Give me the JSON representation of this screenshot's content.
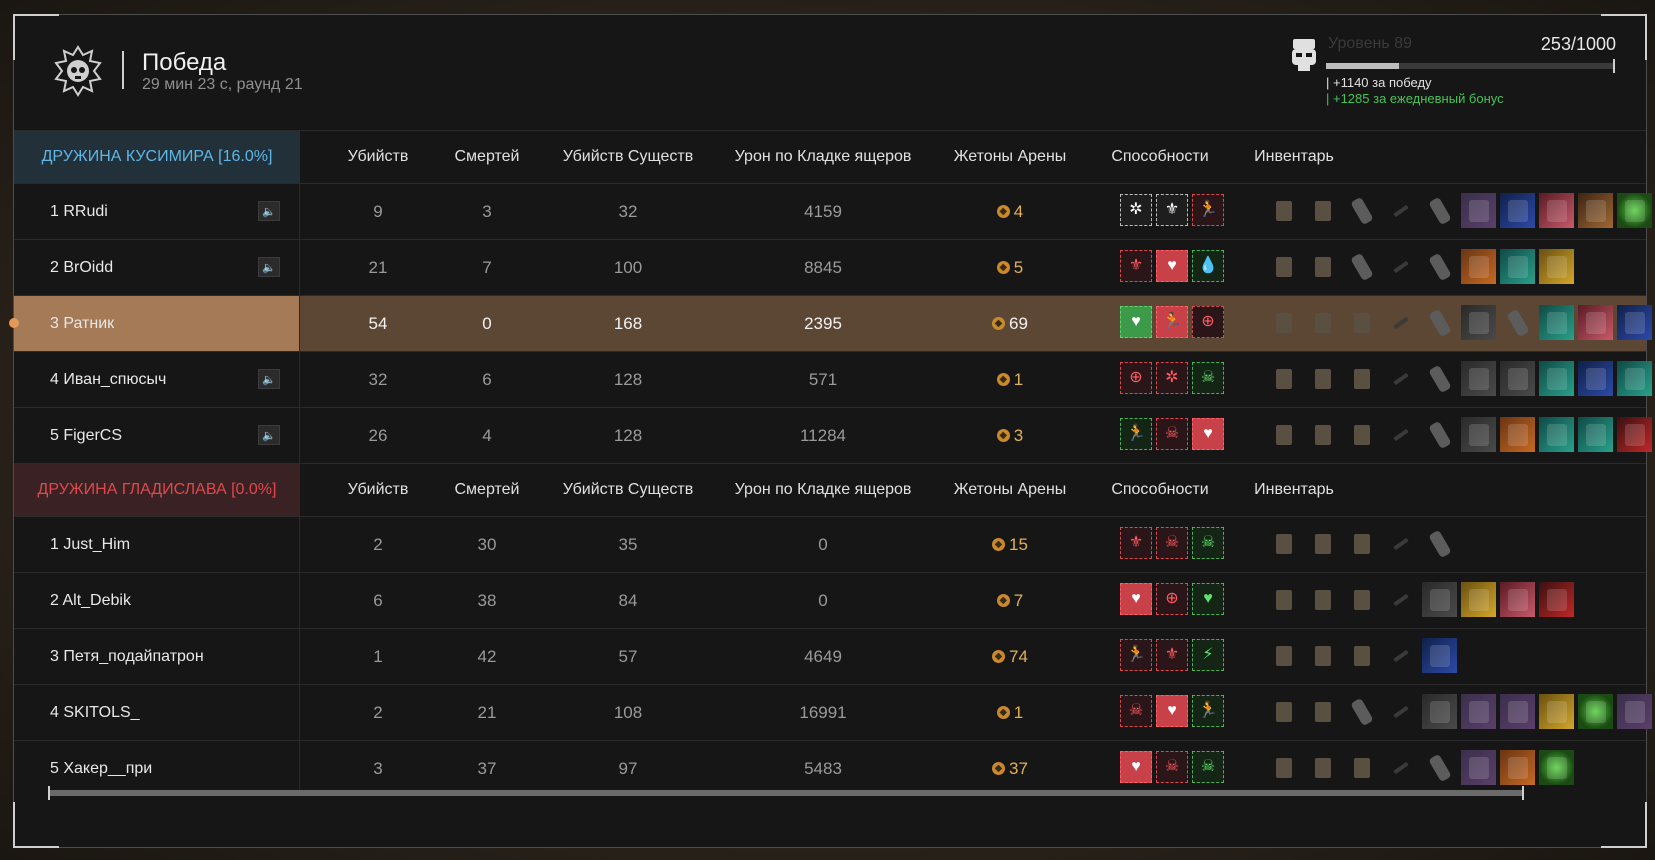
{
  "header": {
    "title": "Победа",
    "subtitle": "29 мин 23 с, раунд 21",
    "level_label": "Уровень 89",
    "xp_value": "253/1000",
    "xp_fraction": 0.253,
    "bonus_win": "| +1140 за победу",
    "bonus_daily": "| +1285 за ежедневный бонус"
  },
  "columns": [
    "Убийств",
    "Смертей",
    "Убийств Существ",
    "Урон по Кладке ящеров",
    "Жетоны Арены",
    "Способности",
    "Инвентарь"
  ],
  "teams": [
    {
      "name": "ДРУЖИНА КУСИМИРА [16.0%]",
      "color": "#5fb6e6",
      "players": [
        {
          "name": "1 RRudi",
          "kills": "9",
          "deaths": "3",
          "creature_kills": "32",
          "damage": "4159",
          "tokens": "4",
          "sound": true,
          "abilities": [
            "white",
            "white",
            "red"
          ],
          "ability_glyphs": [
            "✲",
            "⚜",
            "🏃"
          ],
          "inventory": [
            "vest",
            "vest",
            "pipe",
            "dim",
            "pipe",
            "rare",
            "blue",
            "pink",
            "brown",
            "green"
          ]
        },
        {
          "name": "2 BrOidd",
          "kills": "21",
          "deaths": "7",
          "creature_kills": "100",
          "damage": "8845",
          "tokens": "5",
          "sound": true,
          "abilities": [
            "red",
            "filled-red",
            "green"
          ],
          "ability_glyphs": [
            "⚜",
            "♥",
            "💧"
          ],
          "inventory": [
            "vest",
            "vest",
            "pipe",
            "dim",
            "pipe",
            "orange",
            "teal",
            "gold"
          ]
        },
        {
          "name": "3 Ратник",
          "kills": "54",
          "deaths": "0",
          "creature_kills": "168",
          "damage": "2395",
          "tokens": "69",
          "sound": false,
          "highlight": true,
          "abilities": [
            "filled-green",
            "filled-red",
            "red"
          ],
          "ability_glyphs": [
            "♥",
            "🏃",
            "⊕"
          ],
          "inventory": [
            "vest",
            "vest",
            "vest",
            "dim",
            "pipe",
            "gray",
            "pipe",
            "teal",
            "pink",
            "blue"
          ]
        },
        {
          "name": "4 Иван_спюсыч",
          "kills": "32",
          "deaths": "6",
          "creature_kills": "128",
          "damage": "571",
          "tokens": "1",
          "sound": true,
          "abilities": [
            "red",
            "red",
            "green"
          ],
          "ability_glyphs": [
            "⊕",
            "✲",
            "☠"
          ],
          "inventory": [
            "vest",
            "vest",
            "vest",
            "dim",
            "pipe",
            "gray",
            "gray",
            "teal",
            "blue",
            "teal"
          ]
        },
        {
          "name": "5 FigerCS",
          "kills": "26",
          "deaths": "4",
          "creature_kills": "128",
          "damage": "11284",
          "tokens": "3",
          "sound": true,
          "abilities": [
            "green",
            "red",
            "filled-red"
          ],
          "ability_glyphs": [
            "🏃",
            "☠",
            "♥"
          ],
          "inventory": [
            "vest",
            "vest",
            "vest",
            "dim",
            "pipe",
            "gray",
            "orange",
            "teal",
            "teal",
            "red"
          ]
        }
      ]
    },
    {
      "name": "ДРУЖИНА ГЛАДИСЛАВА [0.0%]",
      "color": "#e0484c",
      "players": [
        {
          "name": "1 Just_Him",
          "kills": "2",
          "deaths": "30",
          "creature_kills": "35",
          "damage": "0",
          "tokens": "15",
          "sound": false,
          "abilities": [
            "red",
            "red",
            "green"
          ],
          "ability_glyphs": [
            "⚜",
            "☠",
            "☠"
          ],
          "inventory": [
            "vest",
            "vest",
            "vest",
            "dim",
            "pipe"
          ]
        },
        {
          "name": "2 Alt_Debik",
          "kills": "6",
          "deaths": "38",
          "creature_kills": "84",
          "damage": "0",
          "tokens": "7",
          "sound": false,
          "abilities": [
            "filled-red",
            "red",
            "green"
          ],
          "ability_glyphs": [
            "♥",
            "⊕",
            "♥"
          ],
          "inventory": [
            "vest",
            "vest",
            "vest",
            "dim",
            "gray",
            "gold",
            "pink",
            "red"
          ]
        },
        {
          "name": "3 Петя_подайпатрон",
          "kills": "1",
          "deaths": "42",
          "creature_kills": "57",
          "damage": "4649",
          "tokens": "74",
          "sound": false,
          "abilities": [
            "red",
            "red",
            "green"
          ],
          "ability_glyphs": [
            "🏃",
            "⚜",
            "⚡"
          ],
          "inventory": [
            "vest",
            "vest",
            "vest",
            "dim",
            "blue"
          ]
        },
        {
          "name": "4 SKITOLS_",
          "kills": "2",
          "deaths": "21",
          "creature_kills": "108",
          "damage": "16991",
          "tokens": "1",
          "sound": false,
          "abilities": [
            "red",
            "filled-red",
            "green"
          ],
          "ability_glyphs": [
            "☠",
            "♥",
            "🏃"
          ],
          "inventory": [
            "vest",
            "vest",
            "pipe",
            "dim",
            "gray",
            "rare",
            "rare",
            "gold",
            "green",
            "rare"
          ]
        },
        {
          "name": "5 Хакер__при",
          "kills": "3",
          "deaths": "37",
          "creature_kills": "97",
          "damage": "5483",
          "tokens": "37",
          "sound": false,
          "abilities": [
            "filled-red",
            "red",
            "green"
          ],
          "ability_glyphs": [
            "♥",
            "☠",
            "☠"
          ],
          "inventory": [
            "vest",
            "vest",
            "vest",
            "dim",
            "pipe",
            "rare",
            "orange",
            "green"
          ]
        }
      ]
    }
  ]
}
